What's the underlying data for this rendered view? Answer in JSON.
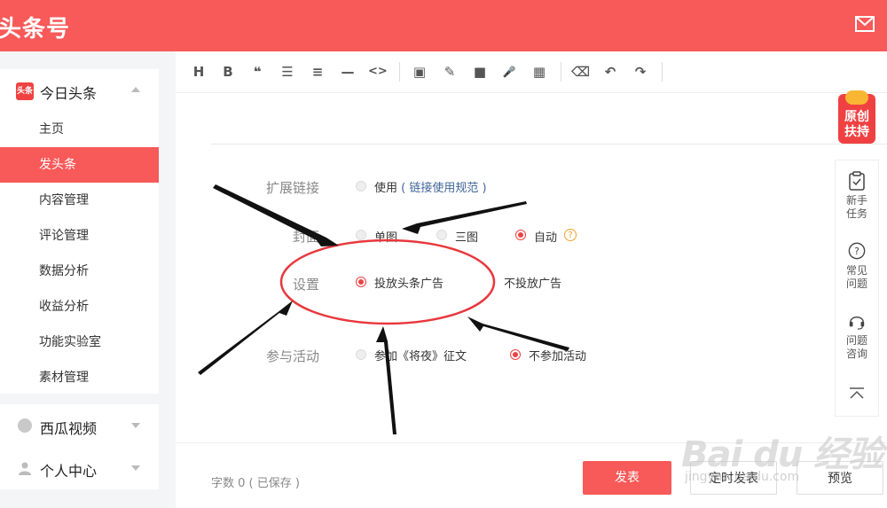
{
  "header": {
    "brand": "头条号",
    "mail_icon": "mail-icon"
  },
  "sidebar": {
    "main_section": {
      "label": "今日头条",
      "logo_text": "头条",
      "items": [
        {
          "label": "主页",
          "active": false
        },
        {
          "label": "发头条",
          "active": true
        },
        {
          "label": "内容管理",
          "active": false
        },
        {
          "label": "评论管理",
          "active": false
        },
        {
          "label": "数据分析",
          "active": false
        },
        {
          "label": "收益分析",
          "active": false
        },
        {
          "label": "功能实验室",
          "active": false
        },
        {
          "label": "素材管理",
          "active": false
        }
      ]
    },
    "groups": [
      {
        "label": "西瓜视频",
        "icon": "xigua-icon"
      },
      {
        "label": "个人中心",
        "icon": "user-icon"
      }
    ]
  },
  "toolbar": {
    "buttons": [
      "H",
      "B",
      "❝",
      "☰",
      "≡",
      "—",
      "<>",
      "▣",
      "✎",
      "■",
      "🎤",
      "▦",
      "⌫",
      "↶",
      "↷"
    ]
  },
  "form": {
    "ext_link": {
      "label": "扩展链接",
      "option": "使用",
      "link_text": "链接使用规范",
      "paren_open": "(",
      "paren_close": ")"
    },
    "cover": {
      "label": "封面",
      "opt_single": "单图",
      "opt_triple": "三图",
      "opt_auto": "自动",
      "selected": "auto",
      "help": "?"
    },
    "ad": {
      "label": "设置",
      "opt_on": "投放头条广告",
      "opt_off": "不投放广告",
      "selected": "on"
    },
    "activity": {
      "label": "参与活动",
      "opt_join": "参加《将夜》征文",
      "opt_no": "不参加活动",
      "selected": "no"
    }
  },
  "footer": {
    "word_count": "字数 0 ( 已保存 )",
    "publish": "发表",
    "schedule": "定时发表",
    "preview": "预览"
  },
  "right_panel": {
    "badge_line1": "原创",
    "badge_line2": "扶持",
    "tools": [
      {
        "line1": "新手",
        "line2": "任务",
        "icon": "clipboard-check-icon"
      },
      {
        "line1": "常见",
        "line2": "问题",
        "icon": "question-icon"
      },
      {
        "line1": "问题",
        "line2": "咨询",
        "icon": "headset-icon"
      }
    ]
  },
  "watermark": {
    "text": "Bai du 经验",
    "sub": "jingyan.baidu.com"
  },
  "colors": {
    "brand": "#f85959",
    "accent_red": "#f04142",
    "link": "#406599"
  }
}
